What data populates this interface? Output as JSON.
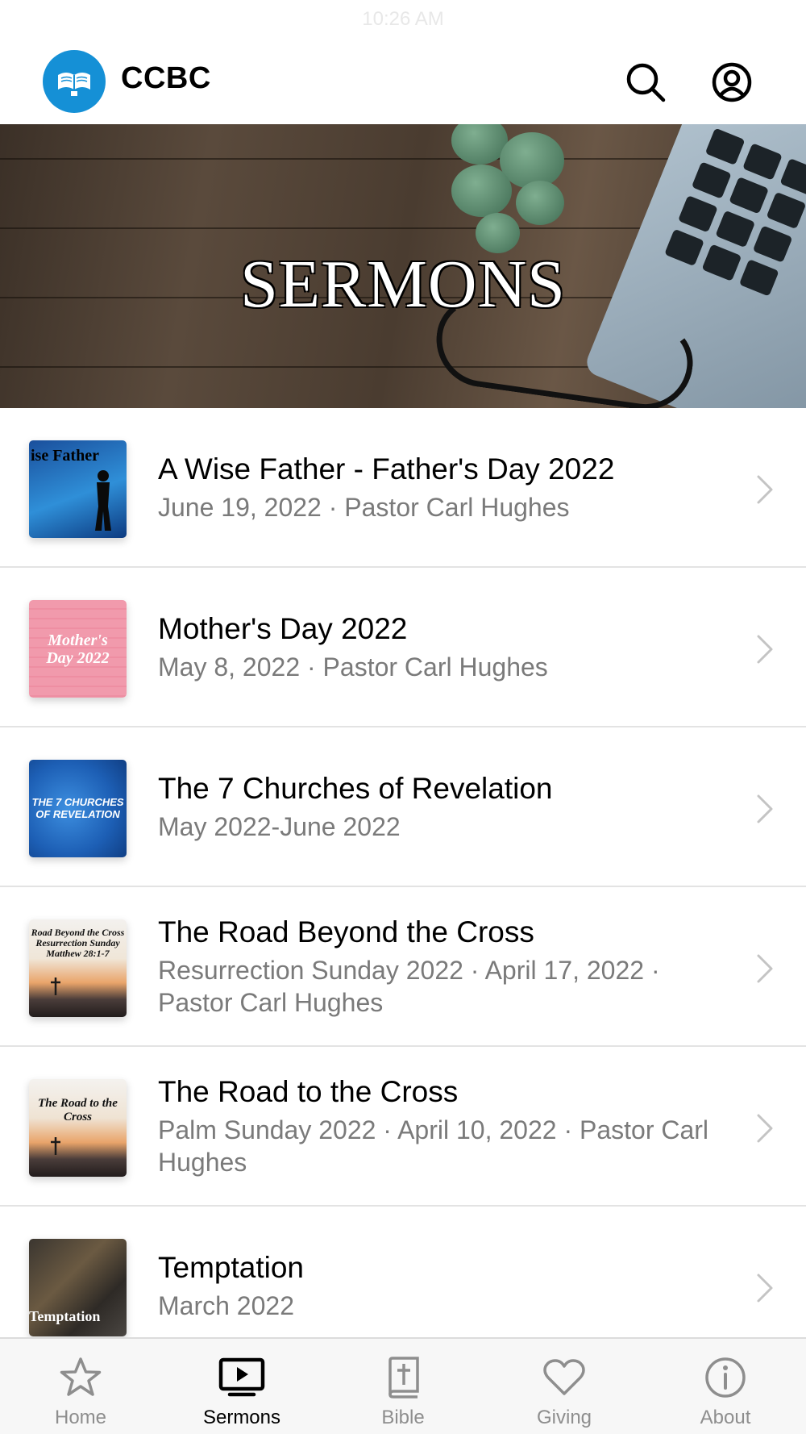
{
  "status_bar": {
    "time": "10:26 AM"
  },
  "header": {
    "app_title": "CCBC",
    "logo_icon": "open-bible-icon",
    "brand_color": "#1590d6"
  },
  "hero": {
    "title": "SERMONS"
  },
  "sermons": [
    {
      "title": "A Wise Father - Father's Day 2022",
      "subtitle": "June 19, 2022 · Pastor Carl Hughes",
      "thumb_text": "ise Father"
    },
    {
      "title": "Mother's Day 2022",
      "subtitle": "May 8, 2022 · Pastor Carl Hughes",
      "thumb_text": "Mother's Day 2022"
    },
    {
      "title": "The 7 Churches of Revelation",
      "subtitle": "May 2022-June 2022",
      "thumb_text": "THE 7 CHURCHES OF REVELATION"
    },
    {
      "title": "The Road Beyond the Cross",
      "subtitle": "Resurrection Sunday 2022 · April 17, 2022 · Pastor Carl Hughes",
      "thumb_text": "Road Beyond the Cross Resurrection Sunday Matthew 28:1-7"
    },
    {
      "title": "The Road to the Cross",
      "subtitle": "Palm Sunday 2022 · April 10, 2022 · Pastor Carl Hughes",
      "thumb_text": "The Road to the Cross"
    },
    {
      "title": "Temptation",
      "subtitle": "March 2022",
      "thumb_text": "Temptation"
    }
  ],
  "tabs": [
    {
      "label": "Home",
      "icon": "star-icon",
      "active": false
    },
    {
      "label": "Sermons",
      "icon": "tv-play-icon",
      "active": true
    },
    {
      "label": "Bible",
      "icon": "bible-cross-icon",
      "active": false
    },
    {
      "label": "Giving",
      "icon": "heart-icon",
      "active": false
    },
    {
      "label": "About",
      "icon": "info-icon",
      "active": false
    }
  ]
}
